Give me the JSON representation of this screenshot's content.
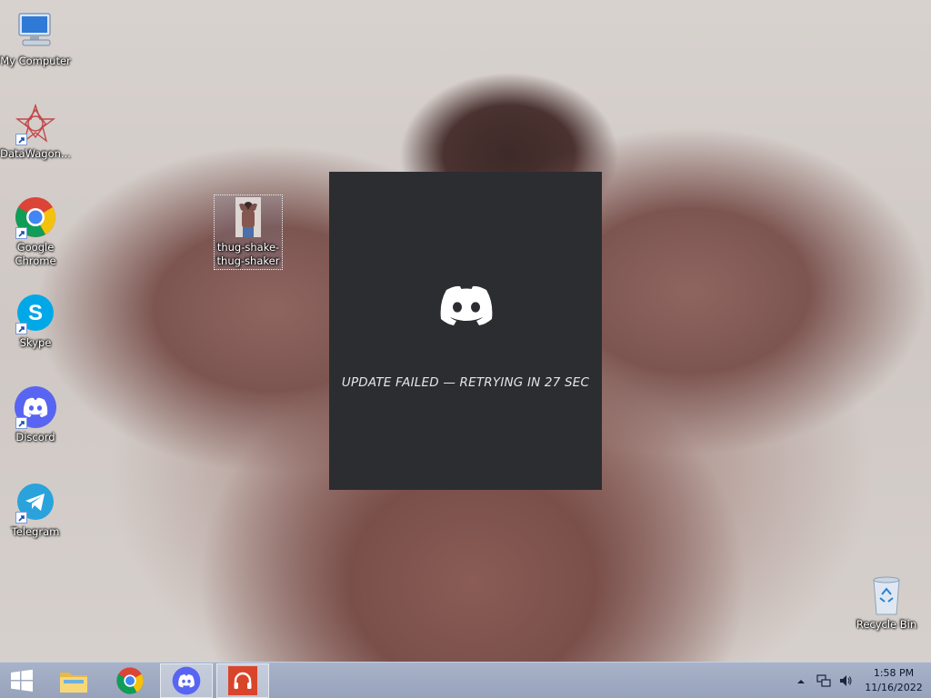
{
  "desktop": {
    "icons": [
      {
        "label": "My Computer"
      },
      {
        "label": "DataWagon..."
      },
      {
        "label": "Google Chrome"
      },
      {
        "label": "Skype"
      },
      {
        "label": "Discord"
      },
      {
        "label": "Telegram"
      },
      {
        "label": "thug-shake-thug-shaker"
      },
      {
        "label": "Recycle Bin"
      }
    ]
  },
  "discord_window": {
    "status_text": "UPDATE FAILED — RETRYING IN 27 SEC",
    "accent_color": "#2b2d31"
  },
  "taskbar": {
    "time": "1:58 PM",
    "date": "11/16/2022",
    "pinned": [
      "start-icon",
      "file-explorer-icon",
      "chrome-icon",
      "discord-icon",
      "headphones-app-icon"
    ]
  }
}
